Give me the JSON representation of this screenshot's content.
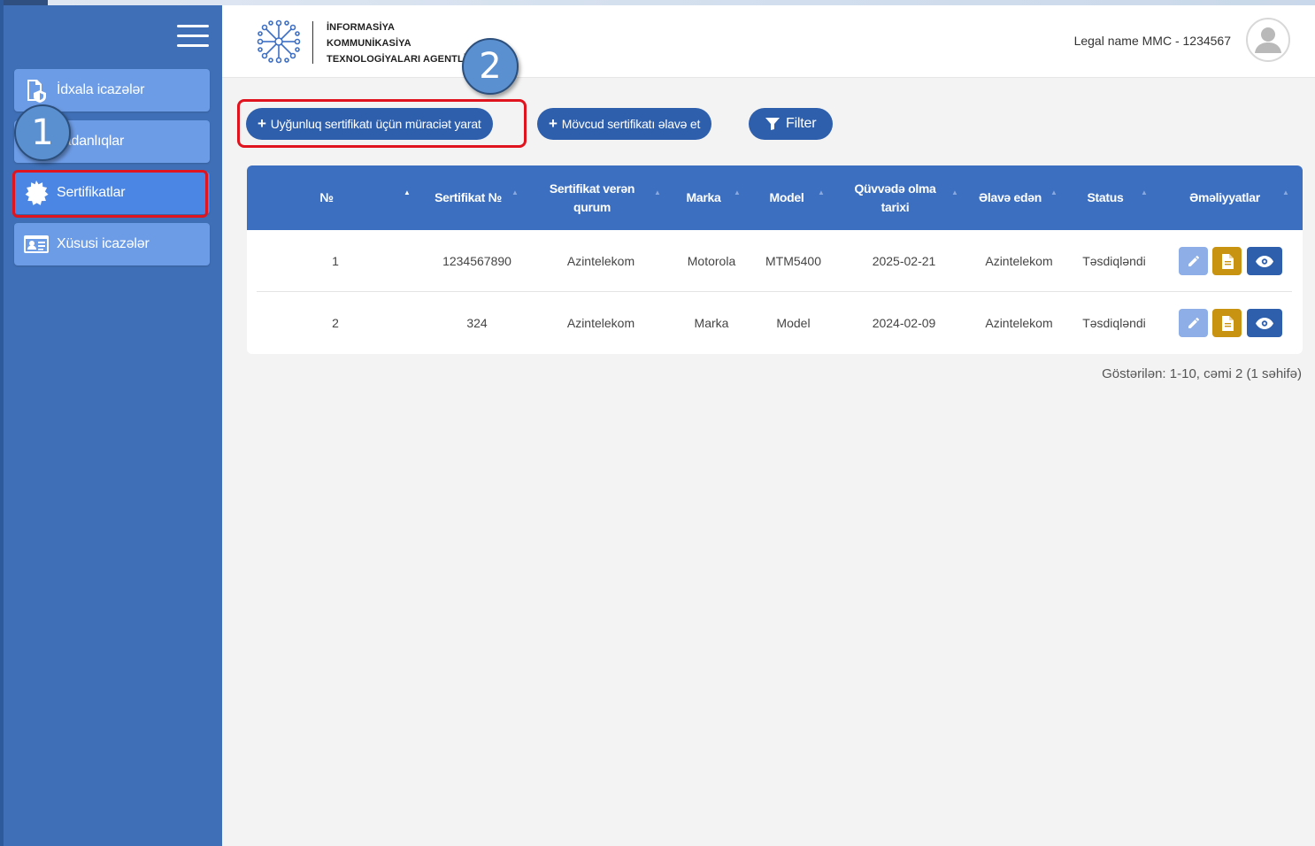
{
  "app": {
    "org_line1": "İNFORMASİYA",
    "org_line2": "KOMMUNİKASİYA",
    "org_line3": "TEXNOLOGİYALARI AGENTLİ",
    "user_label": "Legal name MMC - 1234567"
  },
  "sidebar": {
    "items": [
      {
        "label": "İdxala icazələr",
        "icon": "document-shield-icon",
        "active": false
      },
      {
        "label": "vadanlıqlar",
        "icon": "equipment-icon",
        "active": false
      },
      {
        "label": "Sertifikatlar",
        "icon": "certificate-badge-icon",
        "active": true
      },
      {
        "label": "Xüsusi icazələr",
        "icon": "id-card-icon",
        "active": false
      }
    ]
  },
  "toolbar": {
    "create_label": "Uyğunluq sertifikatı üçün müraciət yarat",
    "add_existing_label": "Mövcud sertifikatı əlavə et",
    "filter_label": "Filter",
    "plus": "+"
  },
  "table": {
    "headers": [
      {
        "label": "№"
      },
      {
        "label": "Sertifikat №"
      },
      {
        "label": "Sertifikat verən qurum"
      },
      {
        "label": "Marka"
      },
      {
        "label": "Model"
      },
      {
        "label": "Qüvvədə olma tarixi"
      },
      {
        "label": "Əlavə edən"
      },
      {
        "label": "Status"
      },
      {
        "label": "Əməliyyatlar"
      }
    ],
    "rows": [
      {
        "no": "1",
        "cert_no": "1234567890",
        "issuer": "Azintelekom",
        "brand": "Motorola",
        "model": "MTM5400",
        "valid_date": "2025-02-21",
        "added_by": "Azintelekom",
        "status": "Təsdiqləndi"
      },
      {
        "no": "2",
        "cert_no": "324",
        "issuer": "Azintelekom",
        "brand": "Marka",
        "model": "Model",
        "valid_date": "2024-02-09",
        "added_by": "Azintelekom",
        "status": "Təsdiqləndi"
      }
    ]
  },
  "pagination": {
    "summary": "Göstərilən: 1-10, cəmi 2 (1 səhifə)"
  },
  "callouts": {
    "one": "1",
    "two": "2"
  },
  "colors": {
    "sidebar": "#3f6fb6",
    "nav_item": "#6d9ce6",
    "nav_active": "#4c86e4",
    "table_header": "#3c6fc0",
    "primary_button": "#2e5fad",
    "highlight_border": "#e0141e",
    "doc_button": "#c89310",
    "edit_button": "#8daee6"
  }
}
